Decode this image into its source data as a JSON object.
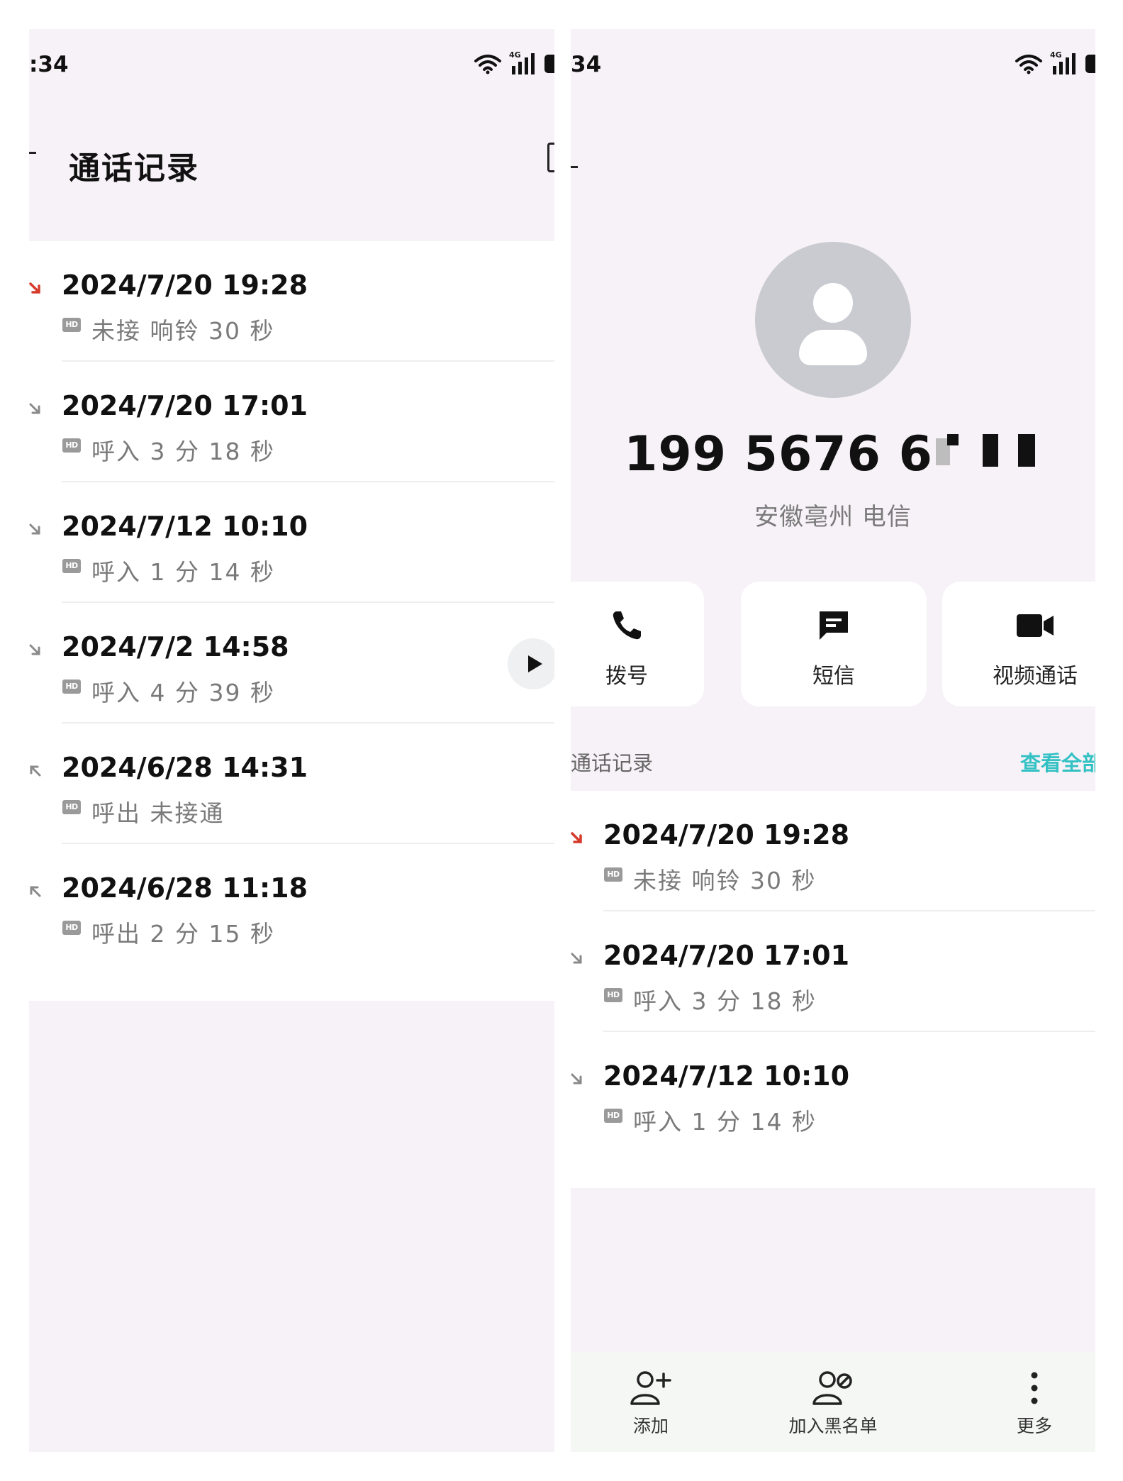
{
  "status_bar": {
    "time": ":34",
    "network": "4G"
  },
  "left": {
    "title": "通话记录",
    "calls": [
      {
        "date": "2024/7/20 19:28",
        "badge": "HD",
        "detail": "未接 响铃 30 秒",
        "type": "missed"
      },
      {
        "date": "2024/7/20 17:01",
        "badge": "HD",
        "detail": "呼入 3 分 18 秒",
        "type": "incoming"
      },
      {
        "date": "2024/7/12 10:10",
        "badge": "HD",
        "detail": "呼入 1 分 14 秒",
        "type": "incoming"
      },
      {
        "date": "2024/7/2 14:58",
        "badge": "HD",
        "detail": "呼入 4 分 39 秒",
        "type": "incoming"
      },
      {
        "date": "2024/6/28 14:31",
        "badge": "HD",
        "detail": "呼出 未接通",
        "type": "outgoing"
      },
      {
        "date": "2024/6/28 11:18",
        "badge": "HD",
        "detail": "呼出 2 分 15 秒",
        "type": "outgoing"
      }
    ]
  },
  "right": {
    "status_time": "34",
    "phone_number": "199 5676 6",
    "location": "安徽亳州 电信",
    "actions": {
      "dial": "拨号",
      "sms": "短信",
      "video": "视频通话"
    },
    "section_title": "通话记录",
    "view_all": "查看全部",
    "calls": [
      {
        "date": "2024/7/20 19:28",
        "badge": "HD",
        "detail": "未接 响铃 30 秒",
        "type": "missed"
      },
      {
        "date": "2024/7/20 17:01",
        "badge": "HD",
        "detail": "呼入 3 分 18 秒",
        "type": "incoming"
      },
      {
        "date": "2024/7/12 10:10",
        "badge": "HD",
        "detail": "呼入 1 分 14 秒",
        "type": "incoming"
      }
    ],
    "bottom": {
      "add": "添加",
      "block": "加入黑名单",
      "more": "更多"
    }
  },
  "colors": {
    "missed": "#d63a2b",
    "normal_icon": "#8a8a8a",
    "accent": "#33c1c4",
    "panel_bg": "#f7f2f7"
  }
}
